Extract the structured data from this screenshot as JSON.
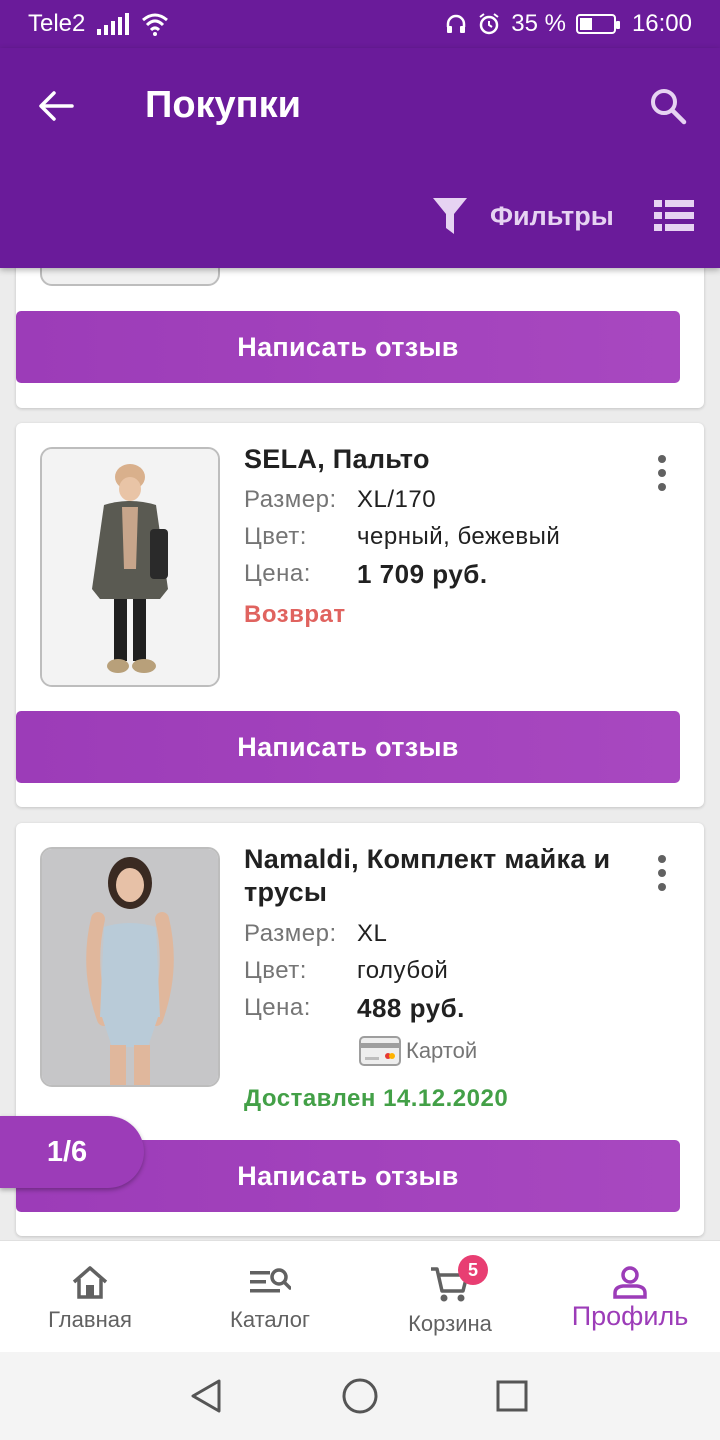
{
  "status_bar": {
    "carrier": "Tele2",
    "battery_percent": "35 %",
    "time": "16:00"
  },
  "header": {
    "title": "Покупки",
    "filter_label": "Фильтры"
  },
  "orders": [
    {
      "name": "SELA, Пальто",
      "size_label": "Размер:",
      "size": "XL/170",
      "color_label": "Цвет:",
      "color": "черный, бежевый",
      "price_label": "Цена:",
      "price": "1 709 руб.",
      "status": "Возврат",
      "status_color": "#e0635f"
    },
    {
      "name": "Namaldi, Комплект майка и трусы",
      "size_label": "Размер:",
      "size": "XL",
      "color_label": "Цвет:",
      "color": "голубой",
      "price_label": "Цена:",
      "price": "488 руб.",
      "payment": "Картой",
      "status": "Доставлен 14.12.2020",
      "status_color": "#43a047"
    }
  ],
  "review_button_label": "Написать отзыв",
  "pager": "1/6",
  "bottom_nav": {
    "items": [
      {
        "label": "Главная",
        "icon": "home-icon"
      },
      {
        "label": "Каталог",
        "icon": "catalog-search-icon"
      },
      {
        "label": "Корзина",
        "icon": "cart-icon",
        "badge": "5"
      },
      {
        "label": "Профиль",
        "icon": "profile-icon",
        "active": true
      }
    ]
  },
  "colors": {
    "primary": "#6a1b9a",
    "accent": "#9c3cb8",
    "badge": "#e83e72"
  }
}
